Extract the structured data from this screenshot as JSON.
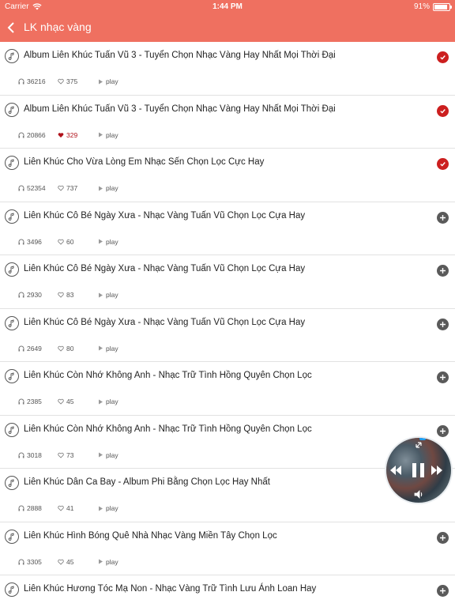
{
  "status_bar": {
    "carrier": "Carrier",
    "time": "1:44 PM",
    "battery": "91%",
    "battery_level": 0.91
  },
  "nav": {
    "title": "LK nhạc vàng"
  },
  "icons": {
    "back": "chevron-left-icon",
    "note": "music-note-icon",
    "listens": "headphones-icon",
    "likes": "heart-icon",
    "play": "play-icon",
    "added": "checkmark-icon",
    "add": "plus-icon"
  },
  "colors": {
    "header": "#ef7060",
    "added": "#cc1f1f",
    "liked": "#b0121b"
  },
  "songs": [
    {
      "title": "Album Liên Khúc Tuấn Vũ 3 - Tuyển Chọn Nhạc Vàng Hay Nhất Mọi Thời Đại",
      "listens": "36216",
      "likes": "375",
      "play": "play",
      "liked": false,
      "added": true
    },
    {
      "title": "Album Liên Khúc Tuấn Vũ 3 - Tuyển Chọn Nhạc Vàng Hay Nhất Mọi Thời Đại",
      "listens": "20866",
      "likes": "329",
      "play": "play",
      "liked": true,
      "added": true
    },
    {
      "title": "Liên Khúc Cho Vừa Lòng Em Nhạc Sến Chọn Lọc Cực Hay",
      "listens": "52354",
      "likes": "737",
      "play": "play",
      "liked": false,
      "added": true
    },
    {
      "title": "Liên Khúc Cô Bé Ngày Xưa - Nhạc Vàng Tuấn Vũ Chọn Lọc Cựa Hay",
      "listens": "3496",
      "likes": "60",
      "play": "play",
      "liked": false,
      "added": false
    },
    {
      "title": "Liên Khúc Cô Bé Ngày Xưa - Nhạc Vàng Tuấn Vũ Chọn Lọc Cựa Hay",
      "listens": "2930",
      "likes": "83",
      "play": "play",
      "liked": false,
      "added": false
    },
    {
      "title": "Liên Khúc Cô Bé Ngày Xưa - Nhạc Vàng Tuấn Vũ Chọn Lọc Cựa Hay",
      "listens": "2649",
      "likes": "80",
      "play": "play",
      "liked": false,
      "added": false
    },
    {
      "title": "Liên Khúc Còn Nhớ Không Anh - Nhạc Trữ Tình Hồng Quyên Chọn Lọc",
      "listens": "2385",
      "likes": "45",
      "play": "play",
      "liked": false,
      "added": false
    },
    {
      "title": "Liên Khúc Còn Nhớ Không Anh - Nhạc Trữ Tình Hồng Quyên Chọn Lọc",
      "listens": "3018",
      "likes": "73",
      "play": "play",
      "liked": false,
      "added": false
    },
    {
      "title": "Liên Khúc Dân Ca Bay - Album Phi Bằng Chọn Lọc Hay Nhất",
      "listens": "2888",
      "likes": "41",
      "play": "play",
      "liked": false,
      "added": false
    },
    {
      "title": "Liên Khúc Hình Bóng Quê Nhà Nhạc Vàng Miền Tây Chọn Lọc",
      "listens": "3305",
      "likes": "45",
      "play": "play",
      "liked": false,
      "added": false
    },
    {
      "title": "Liên Khúc Hương Tóc Mạ Non - Nhạc Vàng Trữ Tình Lưu Ánh Loan Hay",
      "listens": "",
      "likes": "",
      "play": "",
      "liked": false,
      "added": false
    }
  ],
  "mini_player": {
    "state": "playing",
    "controls": [
      "expand-icon",
      "rewind-icon",
      "pause-icon",
      "fast-forward-icon",
      "volume-icon"
    ]
  }
}
